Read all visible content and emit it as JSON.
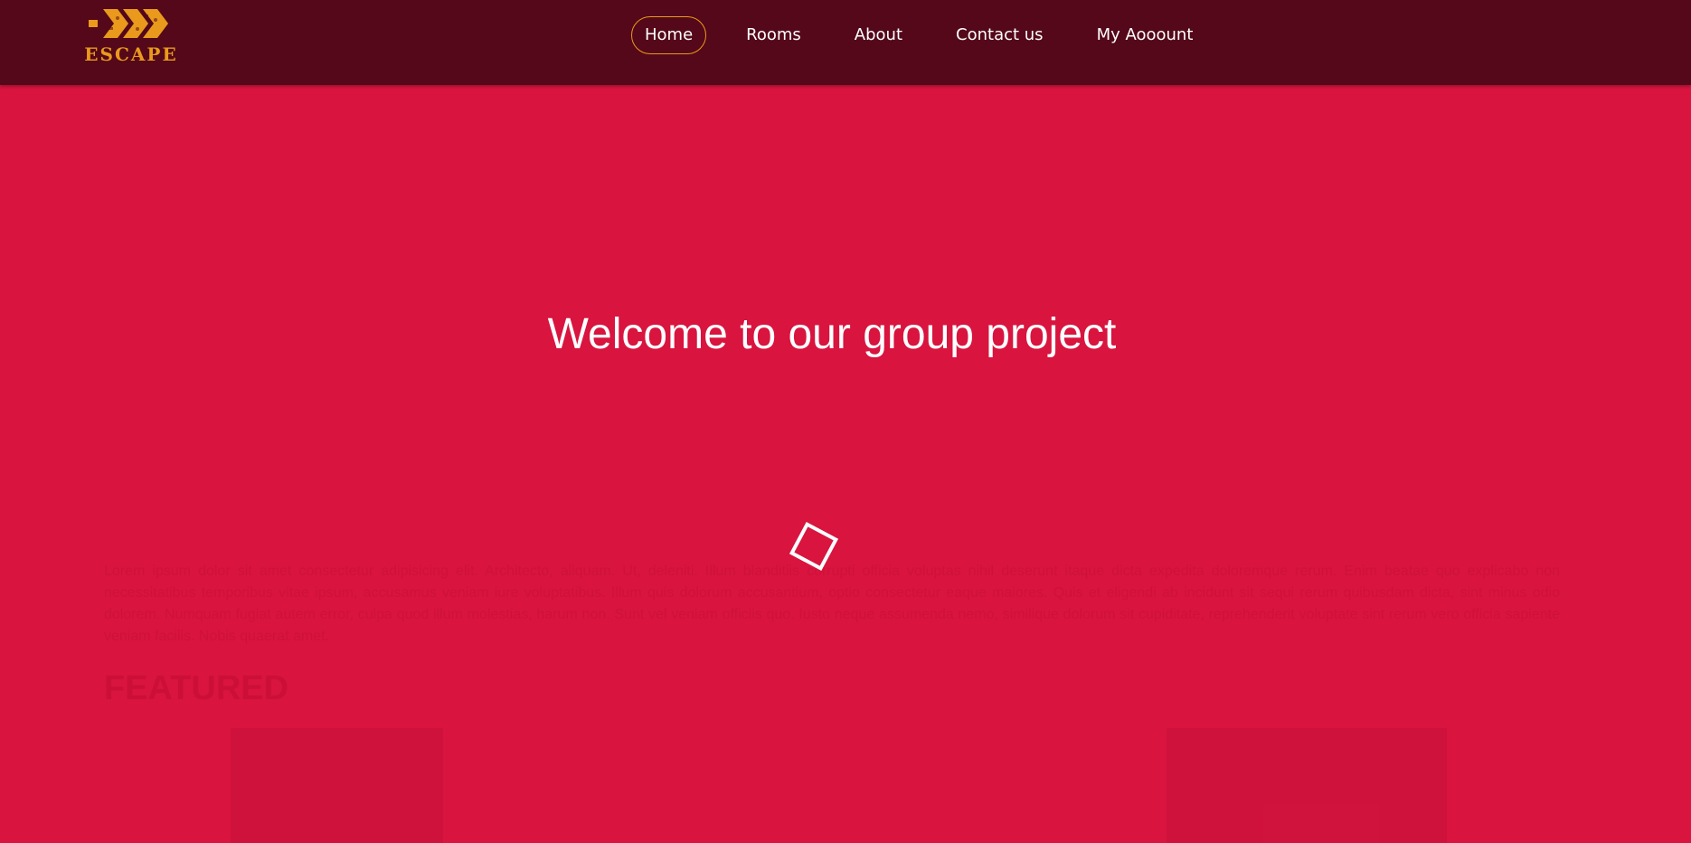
{
  "brand": {
    "name": "ESCAPE",
    "logo_icon": "triple-chevron-icon",
    "accent_color": "#e99a1c"
  },
  "nav": {
    "items": [
      {
        "label": "Home",
        "active": true
      },
      {
        "label": "Rooms",
        "active": false
      },
      {
        "label": "About",
        "active": false
      },
      {
        "label": "Contact us",
        "active": false
      },
      {
        "label": "My Aooount",
        "active": false
      }
    ]
  },
  "hero": {
    "title": "Welcome to our group project",
    "overlay_color": "#d8143f",
    "loader_icon": "rotating-square-loader-icon"
  },
  "faded_content": {
    "paragraph": "Lorem ipsum dolor sit amet consectetur adipisicing elit. Architecto, aliquam. Ut, deleniti. Illum blanditiis corrupti officia voluptas nihil deserunt itaque dicta expedita doloremque rerum. Enim beatae quo explicabo non necessitatibus temporibus vitae ipsum, accusamus veniam iure voluptatibus. Illum quis dolorum accusantium, optio consectetur eaque maiores. Quis et eligendi ab incidunt sit sequi rerum quibusdam dicta, sint minus odio dolorem. Numquam fugiat autem error, culpa quod illum molestias, harum non. Sunt vel veniam officiis quo. Iusto neque assumenda nemo, similique dolorum sit cupiditate, reprehenderit voluptate sint rerum vero officia sapiente veniam facilis. Nobis quaerat amet.",
    "heading": "FEATURED"
  }
}
